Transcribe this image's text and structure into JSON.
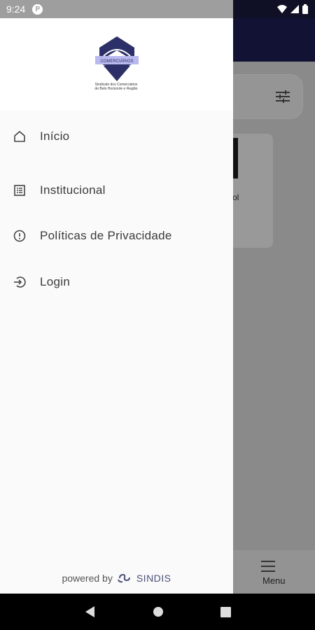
{
  "status": {
    "time": "9:24",
    "notification_badge": "P"
  },
  "background_app": {
    "card_snippet": "ol",
    "bottom_nav_label": "Menu"
  },
  "drawer": {
    "logo": {
      "banner_text": "COMERCIÁRIOS",
      "caption_line1": "Sindicato dos Comerciários",
      "caption_line2": "de Belo Horizonte e Região"
    },
    "items": [
      {
        "label": "Início",
        "icon": "home-icon"
      },
      {
        "label": "Institucional",
        "icon": "document-icon"
      },
      {
        "label": "Políticas de Privacidade",
        "icon": "info-circle-icon"
      },
      {
        "label": "Login",
        "icon": "login-icon"
      }
    ],
    "powered_by": "powered by",
    "brand": "SINDIS"
  },
  "colors": {
    "header_navy": "#121334",
    "brand": "#4a5078"
  }
}
